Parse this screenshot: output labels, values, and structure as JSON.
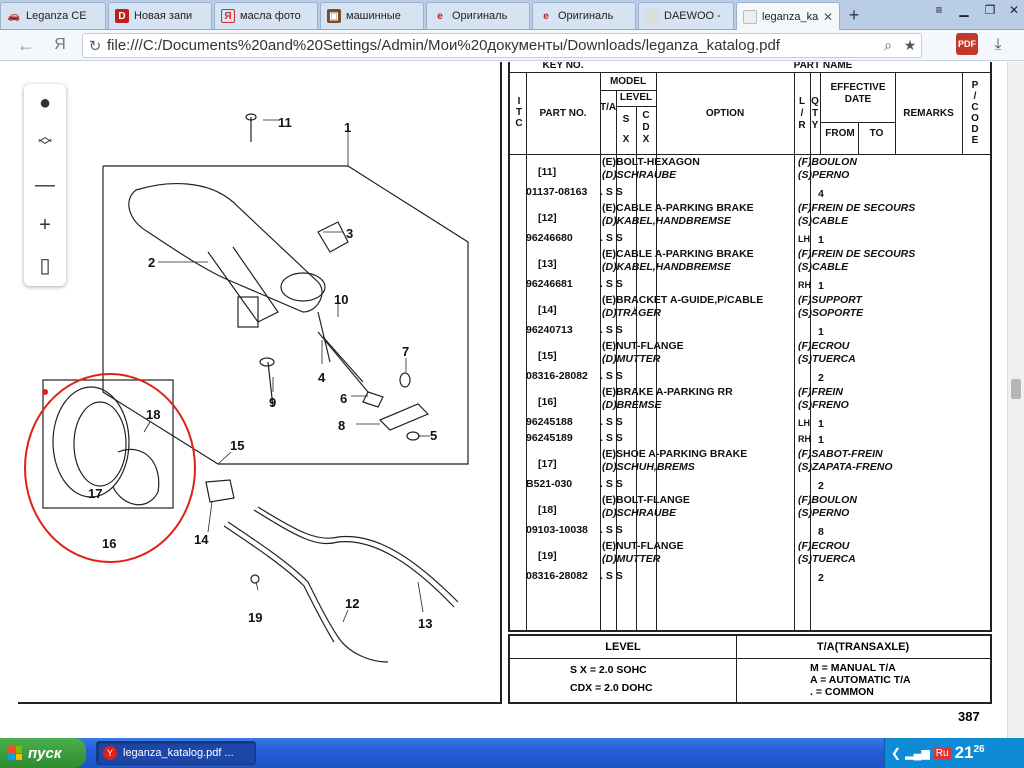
{
  "tabs": [
    {
      "label": "Leganza CE",
      "favicon": "car-icon",
      "color": "#d07a1f"
    },
    {
      "label": "Новая запи",
      "favicon": "D",
      "color": "#c0201b"
    },
    {
      "label": "масла фото",
      "favicon": "Я",
      "color": "#d4302a"
    },
    {
      "label": "машинные",
      "favicon": "image-icon",
      "color": "#7a4b2a"
    },
    {
      "label": "Оригиналь",
      "favicon": "e",
      "color": "#c0201b"
    },
    {
      "label": "Оригиналь",
      "favicon": "e",
      "color": "#c0201b"
    },
    {
      "label": "DAEWOO -",
      "favicon": "",
      "color": "#bbb"
    },
    {
      "label": "leganza_ka",
      "favicon": "pdf-icon",
      "color": "#bbb",
      "active": true
    }
  ],
  "address": {
    "yandex": "Я",
    "url": "file:///C:/Documents%20and%20Settings/Admin/Мои%20документы/Downloads/leganza_katalog.pdf",
    "extension_label": "PDF"
  },
  "table": {
    "key_no": "KEY NO.",
    "part_name": "PART NAME",
    "itc": [
      "I",
      "T",
      "C"
    ],
    "part_no": "PART NO.",
    "model": "MODEL",
    "level": "LEVEL",
    "ta": "T/A",
    "sx": [
      "S",
      "X"
    ],
    "cdx": [
      "C",
      "D",
      "X"
    ],
    "option": "OPTION",
    "lr": [
      "L",
      "/",
      "R"
    ],
    "qty": [
      "Q",
      "T",
      "Y"
    ],
    "effective_date": "EFFECTIVE DATE",
    "from": "FROM",
    "to": "TO",
    "remarks": "REMARKS",
    "pcode": [
      "P",
      "/",
      "C",
      "O",
      "D",
      "E"
    ],
    "rows": [
      {
        "key": "[11]",
        "part": "01137-08163",
        "e": "(E)BOLT-HEXAGON",
        "d": "(D)SCHRAUBE",
        "f": "(F)BOULON",
        "s": "(S)PERNO",
        "lr": "",
        "qty": "4",
        "marks": ". S S"
      },
      {
        "key": "[12]",
        "part": "96246680",
        "e": "(E)CABLE A-PARKING BRAKE",
        "d": "(D)KABEL,HANDBREMSE",
        "f": "(F)FREIN DE SECOURS",
        "s": "(S)CABLE",
        "lr": "LH",
        "qty": "1",
        "marks": ". S S"
      },
      {
        "key": "[13]",
        "part": "96246681",
        "e": "(E)CABLE A-PARKING BRAKE",
        "d": "(D)KABEL,HANDBREMSE",
        "f": "(F)FREIN DE SECOURS",
        "s": "(S)CABLE",
        "lr": "RH",
        "qty": "1",
        "marks": ". S S"
      },
      {
        "key": "[14]",
        "part": "96240713",
        "e": "(E)BRACKET A-GUIDE,P/CABLE",
        "d": "(D)TRÄGER",
        "f": "(F)SUPPORT",
        "s": "(S)SOPORTE",
        "lr": "",
        "qty": "1",
        "marks": ". S S"
      },
      {
        "key": "[15]",
        "part": "08316-28082",
        "e": "(E)NUT-FLANGE",
        "d": "(D)MUTTER",
        "f": "(F)ECROU",
        "s": "(S)TUERCA",
        "lr": "",
        "qty": "2",
        "marks": ". S S"
      }
    ],
    "row16": {
      "key": "[16]",
      "e": "(E)BRAKE A-PARKING RR",
      "d": "(D)BREMSE",
      "f": "(F)FREIN",
      "s": "(S)FRENO",
      "parts": [
        {
          "part": "96245188",
          "lr": "LH",
          "qty": "1",
          "marks": ". S S"
        },
        {
          "part": "96245189",
          "lr": "RH",
          "qty": "1",
          "marks": ". S S"
        }
      ]
    },
    "rows2": [
      {
        "key": "[17]",
        "part": "B521-030",
        "e": "(E)SHOE A-PARKING BRAKE",
        "d": "(D)SCHUH,BREMS",
        "f": "(F)SABOT-FREIN",
        "s": "(S)ZAPATA-FRENO",
        "lr": "",
        "qty": "2",
        "marks": ". S S"
      },
      {
        "key": "[18]",
        "part": "09103-10038",
        "e": "(E)BOLT-FLANGE",
        "d": "(D)SCHRAUBE",
        "f": "(F)BOULON",
        "s": "(S)PERNO",
        "lr": "",
        "qty": "8",
        "marks": ". S S"
      },
      {
        "key": "[19]",
        "part": "08316-28082",
        "e": "(E)NUT-FLANGE",
        "d": "(D)MUTTER",
        "f": "(F)ECROU",
        "s": "(S)TUERCA",
        "lr": "",
        "qty": "2",
        "marks": ". S S"
      }
    ]
  },
  "legend": {
    "level_header": "LEVEL",
    "ta_header": "T/A(TRANSAXLE)",
    "level_lines": [
      "S  X = 2.0 SOHC",
      "CDX = 2.0 DOHC"
    ],
    "ta_lines": [
      "M = MANUAL T/A",
      "A = AUTOMATIC T/A",
      ". = COMMON"
    ]
  },
  "page_number": "387",
  "diagram_labels": [
    "1",
    "2",
    "3",
    "4",
    "5",
    "6",
    "7",
    "8",
    "9",
    "10",
    "11",
    "12",
    "13",
    "14",
    "15",
    "16",
    "17",
    "18",
    "19"
  ],
  "taskbar": {
    "start": "пуск",
    "window": "leganza_katalog.pdf ...",
    "clock_h": "21",
    "clock_m": "26",
    "lang": "Ru"
  }
}
